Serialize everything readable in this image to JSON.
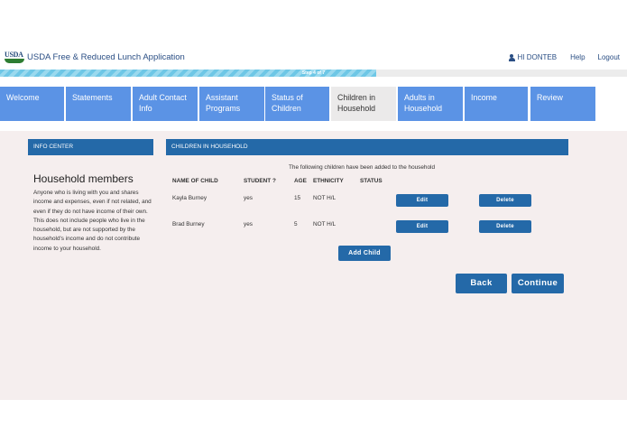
{
  "header": {
    "logo_text": "USDA",
    "app_title": "USDA Free & Reduced Lunch Application",
    "user_greeting": "HI DONTEB",
    "help_label": "Help",
    "logout_label": "Logout"
  },
  "progress": {
    "label": "Step 4 of 7",
    "fraction": 0.6
  },
  "nav": {
    "tabs": [
      {
        "label": "Welcome",
        "active": false
      },
      {
        "label": "Statements",
        "active": false
      },
      {
        "label": "Adult Contact Info",
        "active": false
      },
      {
        "label": "Assistant Programs",
        "active": false
      },
      {
        "label": "Status of Children",
        "active": false
      },
      {
        "label": "Children in Household",
        "active": true
      },
      {
        "label": "Adults in Household",
        "active": false
      },
      {
        "label": "Income",
        "active": false
      },
      {
        "label": "Review",
        "active": false
      }
    ]
  },
  "info_center": {
    "header": "INFO CENTER",
    "title": "Household members",
    "body": "Anyone who is living with you and shares income and expenses, even if not related, and even if they do not have income of their own. This does not include people who live in the household, but are not supported by the household's income and do not contribute income to your household."
  },
  "children": {
    "header": "CHILDREN IN HOUSEHOLD",
    "subtitle": "The following children have been added to the household",
    "columns": {
      "name": "NAME OF CHILD",
      "student": "STUDENT ?",
      "age": "AGE",
      "ethnicity": "ETHNICITY",
      "status": "STATUS"
    },
    "rows": [
      {
        "name": "Kayla Burney",
        "student": "yes",
        "age": "15",
        "ethnicity": "NOT H/L",
        "status": ""
      },
      {
        "name": "Brad Burney",
        "student": "yes",
        "age": "5",
        "ethnicity": "NOT H/L",
        "status": ""
      }
    ],
    "edit_label": "Edit",
    "delete_label": "Delete",
    "add_label": "Add Child"
  },
  "footer": {
    "back_label": "Back",
    "continue_label": "Continue"
  },
  "colors": {
    "tab_blue": "#5b93e5",
    "header_blue": "#2469a8",
    "content_bg": "#f5eeee",
    "progress_stripe": "#6ec7e6"
  }
}
